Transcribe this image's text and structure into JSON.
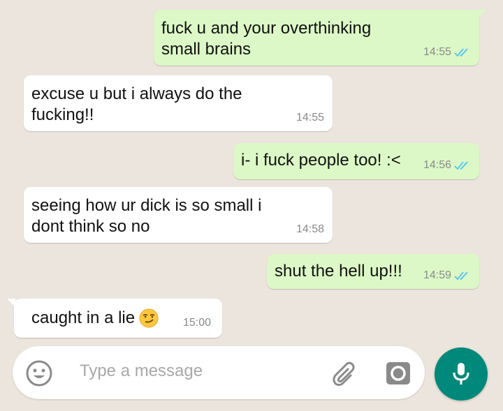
{
  "messages": [
    {
      "direction": "out",
      "text_lines": [
        "fuck u and your overthinking",
        "small brains"
      ],
      "time": "14:55",
      "ticks": true
    },
    {
      "direction": "in",
      "text_lines": [
        "excuse u but i always do the",
        "fucking!!"
      ],
      "time": "14:55",
      "ticks": false
    },
    {
      "direction": "out",
      "text_lines": [
        "i- i fuck people too! :<"
      ],
      "time": "14:56",
      "ticks": true
    },
    {
      "direction": "in",
      "text_lines": [
        "seeing how ur dick is so small i",
        "dont think so no"
      ],
      "time": "14:58",
      "ticks": false
    },
    {
      "direction": "out",
      "text_lines": [
        "shut the hell up!!!"
      ],
      "time": "14:59",
      "ticks": true
    },
    {
      "direction": "in",
      "text_lines": [
        "caught in a lie"
      ],
      "time": "15:00",
      "ticks": false,
      "emoji": "smirking-face"
    }
  ],
  "composer": {
    "placeholder": "Type a message",
    "emoji_icon": "emoji-icon",
    "attach_icon": "paperclip-icon",
    "camera_icon": "camera-icon",
    "send_icon": "microphone-icon"
  },
  "colors": {
    "outgoing_bubble": "#dcf8c6",
    "incoming_bubble": "#ffffff",
    "background": "#ece5dd",
    "read_ticks": "#4fc3f7",
    "mic_button": "#00897b"
  }
}
